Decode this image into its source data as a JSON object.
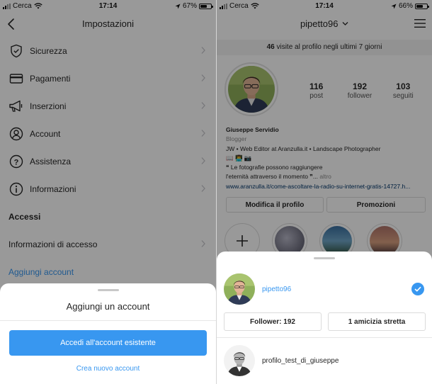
{
  "left": {
    "status": {
      "carrier": "Cerca",
      "time": "17:14",
      "battery": "67%",
      "battery_level": 0.67
    },
    "header": {
      "title": "Impostazioni"
    },
    "menu": [
      {
        "label": "Sicurezza",
        "icon": "shield-icon"
      },
      {
        "label": "Pagamenti",
        "icon": "card-icon"
      },
      {
        "label": "Inserzioni",
        "icon": "megaphone-icon"
      },
      {
        "label": "Account",
        "icon": "user-circle-icon"
      },
      {
        "label": "Assistenza",
        "icon": "help-icon"
      },
      {
        "label": "Informazioni",
        "icon": "info-icon"
      }
    ],
    "accessi": {
      "title": "Accessi",
      "login_info": "Informazioni di accesso",
      "add_account": "Aggiungi account"
    },
    "sheet": {
      "title": "Aggiungi un account",
      "primary": "Accedi all'account esistente",
      "secondary": "Crea nuovo account"
    }
  },
  "right": {
    "status": {
      "carrier": "Cerca",
      "time": "17:14",
      "battery": "66%",
      "battery_level": 0.66
    },
    "header": {
      "username": "pipetto96"
    },
    "visits": {
      "count": "46",
      "text": "visite al profilo negli ultimi 7 giorni"
    },
    "stats": [
      {
        "value": "116",
        "label": "post"
      },
      {
        "value": "192",
        "label": "follower"
      },
      {
        "value": "103",
        "label": "seguiti"
      }
    ],
    "bio": {
      "name": "Giuseppe Servidio",
      "category": "Blogger",
      "line1": "JW • Web Editor at Aranzulla.it • Landscape Photographer",
      "line2": "📖 👨‍💻 📷",
      "line3": "❝ Le fotografie possono raggiungere",
      "line4": "l'eternità attraverso il momento ❞...",
      "more": "altro",
      "url": "www.aranzulla.it/come-ascoltare-la-radio-su-internet-gratis-14727.h..."
    },
    "buttons": {
      "edit_profile": "Modifica il profilo",
      "promotions": "Promozioni"
    },
    "sheet": {
      "account1": "pipetto96",
      "followers_button": "Follower: 192",
      "close_friends_button": "1 amicizia stretta",
      "account2": "profilo_test_di_giuseppe"
    }
  },
  "colors": {
    "accent": "#3897f0",
    "text": "#262626",
    "overlay": "rgba(0,0,0,0.4)"
  }
}
